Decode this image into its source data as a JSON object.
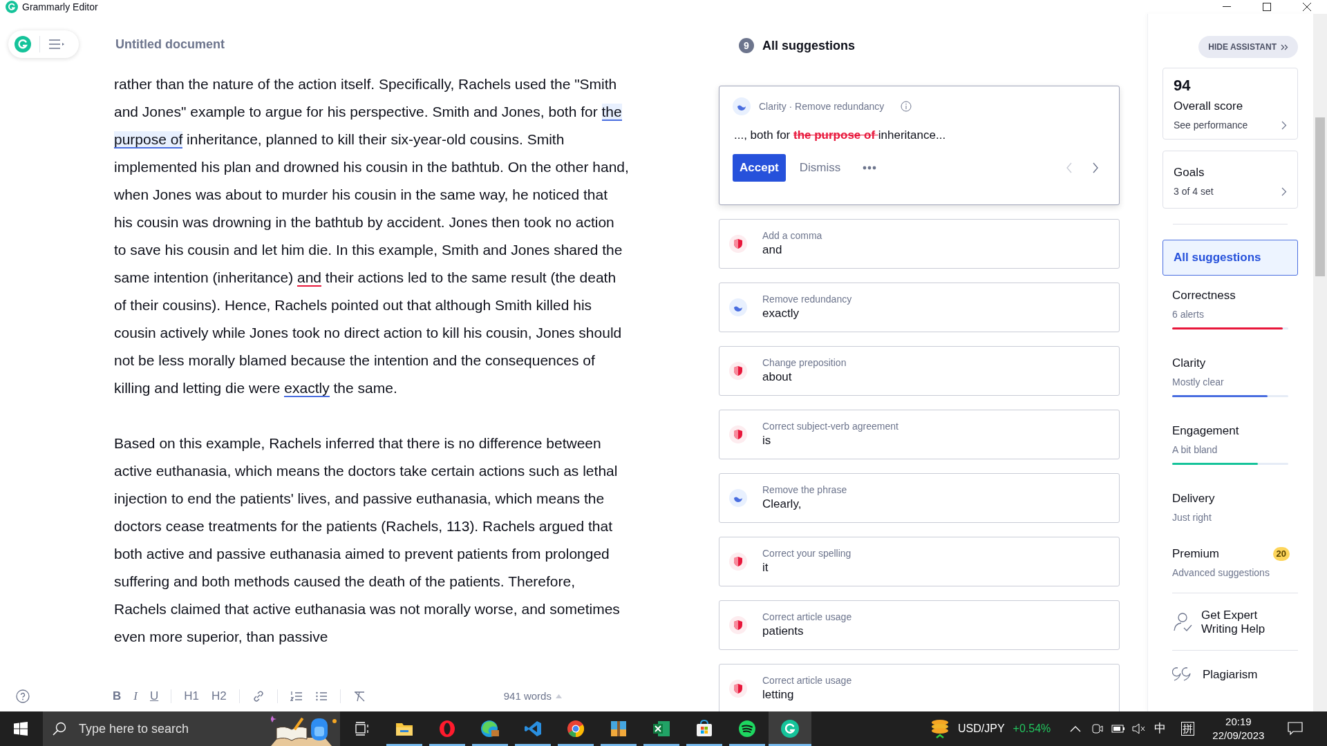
{
  "window": {
    "title": "Grammarly Editor"
  },
  "editor": {
    "title": "Untitled document",
    "paragraphs": [
      [
        {
          "kind": "plain",
          "text": "rather than the nature of the action itself. Specifically, Rachels used the \"Smith and Jones\" example to argue for his perspective. Smith and Jones, both for "
        },
        {
          "kind": "selected",
          "text": "the purpose of"
        },
        {
          "kind": "plain",
          "text": " inheritance, planned to kill their six-year-old cousins. Smith implemented his plan and drowned his cousin in the bathtub. On the other hand, when Jones was about to murder his cousin in the same way, he noticed that his cousin was drowning in the bathtub by accident. Jones then took no action to save his cousin and let him die. In this example, Smith and Jones shared the same intention (inheritance) "
        },
        {
          "kind": "correctness",
          "text": "and"
        },
        {
          "kind": "plain",
          "text": " their actions led to the same result (the death of their cousins). Hence, Rachels pointed out that although Smith killed his cousin actively while Jones took no direct action to kill his cousin, Jones should not be less morally blamed because the intention and the consequences of killing and letting die were "
        },
        {
          "kind": "clarity",
          "text": "exactly"
        },
        {
          "kind": "plain",
          "text": " the same."
        }
      ],
      [
        {
          "kind": "plain",
          "text": "Based on this example, Rachels inferred that there is no difference between active euthanasia, which means the doctors take certain actions such as lethal injection to end the patients' lives, and passive euthanasia, which means the doctors cease treatments for the patients (Rachels, 113). Rachels argued that both active and passive euthanasia aimed to prevent patients from prolonged suffering and both methods caused the death of the patients. Therefore, Rachels claimed that active euthanasia was not morally worse, and sometimes even more superior, than passive"
        }
      ]
    ],
    "toolbar": [
      "B",
      "I",
      "U",
      "H1",
      "H2"
    ],
    "word_count": "941 words"
  },
  "suggestions": {
    "count": "9",
    "title": "All suggestions",
    "active": {
      "kind": "clarity",
      "category": "Clarity · Remove redundancy",
      "preview": [
        {
          "kind": "plain",
          "text": "..., both for "
        },
        {
          "kind": "removed",
          "text": "the purpose of "
        },
        {
          "kind": "plain",
          "text": "inheritance..."
        }
      ],
      "accept": "Accept",
      "dismiss": "Dismiss"
    },
    "items": [
      {
        "kind": "correctness",
        "title": "Add a comma",
        "text": "and"
      },
      {
        "kind": "clarity",
        "title": "Remove redundancy",
        "text": "exactly"
      },
      {
        "kind": "correctness",
        "title": "Change preposition",
        "text": "about"
      },
      {
        "kind": "correctness",
        "title": "Correct subject-verb agreement",
        "text": "is"
      },
      {
        "kind": "clarity",
        "title": "Remove the phrase",
        "text": "Clearly,"
      },
      {
        "kind": "correctness",
        "title": "Correct your spelling",
        "text": "it"
      },
      {
        "kind": "correctness",
        "title": "Correct article usage",
        "text": "patients"
      },
      {
        "kind": "correctness",
        "title": "Correct article usage",
        "text": "letting"
      }
    ]
  },
  "assistant": {
    "hide": "HIDE ASSISTANT",
    "score": "94",
    "score_label": "Overall score",
    "score_link": "See performance",
    "goals": "Goals",
    "goals_value": "3 of 4 set",
    "nav": [
      {
        "label": "All suggestions",
        "selected": true
      }
    ],
    "categories": [
      {
        "name": "Correctness",
        "status": "6 alerts",
        "level": 0.95,
        "color": "#e8173b"
      },
      {
        "name": "Clarity",
        "status": "Mostly clear",
        "level": 0.82,
        "color": "#4a6ee0"
      },
      {
        "name": "Engagement",
        "status": "A bit bland",
        "level": 0.74,
        "color": "#15c39a"
      },
      {
        "name": "Delivery",
        "status": "Just right"
      }
    ],
    "premium": {
      "name": "Premium",
      "status": "Advanced suggestions",
      "badge": "20"
    },
    "expert": "Get Expert Writing Help",
    "plagiarism": "Plagiarism"
  },
  "taskbar": {
    "search_placeholder": "Type here to search",
    "apps": [
      {
        "kind": "folder",
        "running": true,
        "selected": false
      },
      {
        "kind": "opera",
        "running": true,
        "selected": false
      },
      {
        "kind": "edge",
        "running": true,
        "selected": false
      },
      {
        "kind": "code",
        "running": true,
        "selected": false
      },
      {
        "kind": "chrome",
        "running": true,
        "selected": false
      },
      {
        "kind": "archive",
        "running": true,
        "selected": false
      },
      {
        "kind": "excel",
        "running": true,
        "selected": false
      },
      {
        "kind": "store",
        "running": true,
        "selected": false
      },
      {
        "kind": "spotify",
        "running": true,
        "selected": false
      },
      {
        "kind": "grammarly",
        "running": true,
        "selected": true
      }
    ],
    "ticker": "USD/JPY",
    "change": "+0.54%",
    "ime": "中",
    "ime_mode": "拼",
    "time": "20:19",
    "date": "22/09/2023"
  }
}
